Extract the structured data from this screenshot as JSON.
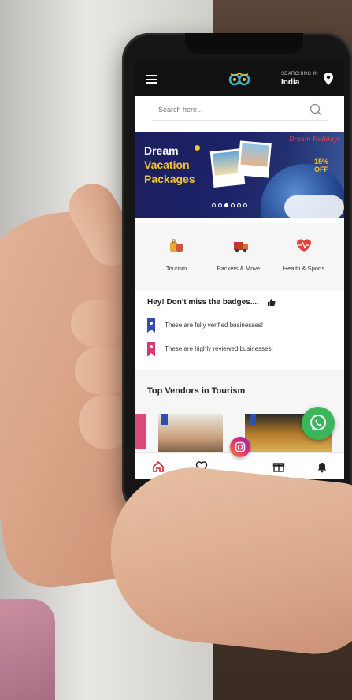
{
  "topbar": {
    "searching_label": "SEARCHING IN",
    "country": "India"
  },
  "search": {
    "placeholder": "Search here..."
  },
  "banner": {
    "title_line1": "Dream",
    "title_line2": "Vacation",
    "title_line3": "Packages",
    "script_text": "Dream Holidays",
    "offer_line1": "15%",
    "offer_line2": "OFF",
    "slides": 6,
    "active_slide": 3
  },
  "categories": [
    {
      "label": "Tourism",
      "icon": "luggage-icon",
      "color": "#e6a92f"
    },
    {
      "label": "Packers & Move...",
      "icon": "truck-icon",
      "color": "#c0392b"
    },
    {
      "label": "Health & Sports",
      "icon": "heart-icon",
      "color": "#e0443e"
    }
  ],
  "badges": {
    "title": "Hey! Don't miss the badges....",
    "items": [
      {
        "text": "These are fully verified businesses!",
        "color": "#2f4fa8"
      },
      {
        "text": "These are highly reviewed businesses!",
        "color": "#d8386b"
      }
    ]
  },
  "vendors": {
    "title": "Top Vendors in Tourism"
  },
  "colors": {
    "accent_red": "#d8232a",
    "whatsapp_green": "#3cb65a"
  }
}
